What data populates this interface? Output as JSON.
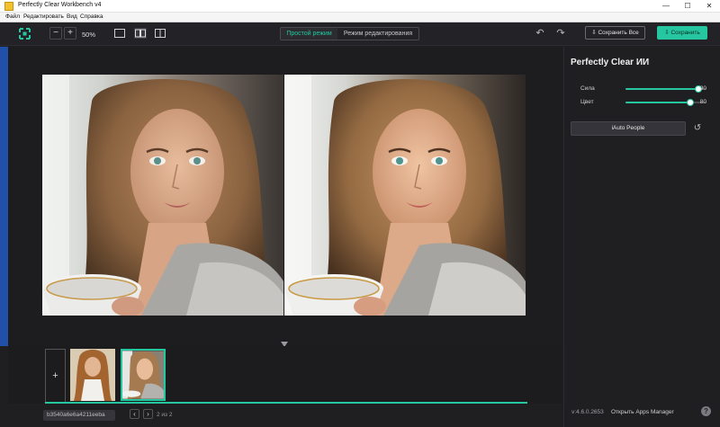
{
  "window": {
    "title": "Perfectly Clear Workbench v4",
    "minimize_glyph": "—",
    "maximize_glyph": "☐",
    "close_glyph": "✕"
  },
  "menu": {
    "items": [
      "Файл",
      "Редактировать",
      "Вид",
      "Справка"
    ]
  },
  "toolbar": {
    "zoom_out": "−",
    "zoom_in": "+",
    "zoom_level": "50%",
    "mode_simple": "Простой режим",
    "mode_edit": "Режим редактирования",
    "undo_glyph": "↶",
    "redo_glyph": "↷",
    "save_all": "Сохранить Все",
    "save": "Сохранить",
    "accent": "#26c6a0"
  },
  "filmstrip": {
    "add_glyph": "+",
    "filename": "b3540a6e6a4211eeba",
    "prev_glyph": "‹",
    "next_glyph": "›",
    "page_count": "2 из 2"
  },
  "panel": {
    "title": "Perfectly Clear ИИ",
    "sliders": [
      {
        "label": "Сила",
        "value": "90",
        "fraction": 0.9
      },
      {
        "label": "Цвет",
        "value": "80",
        "fraction": 0.8
      }
    ],
    "iauto_button": "iAuto People",
    "reset_glyph": "↺",
    "version": "v:4.6.0.2653",
    "apps_manager": "Открыть Apps Manager",
    "help_glyph": "?"
  },
  "icons": {
    "logo": "perfectly-clear-logo-icon",
    "single_view": "single-view-icon",
    "side_by_side": "side-by-side-view-icon",
    "split_view": "split-view-icon"
  }
}
